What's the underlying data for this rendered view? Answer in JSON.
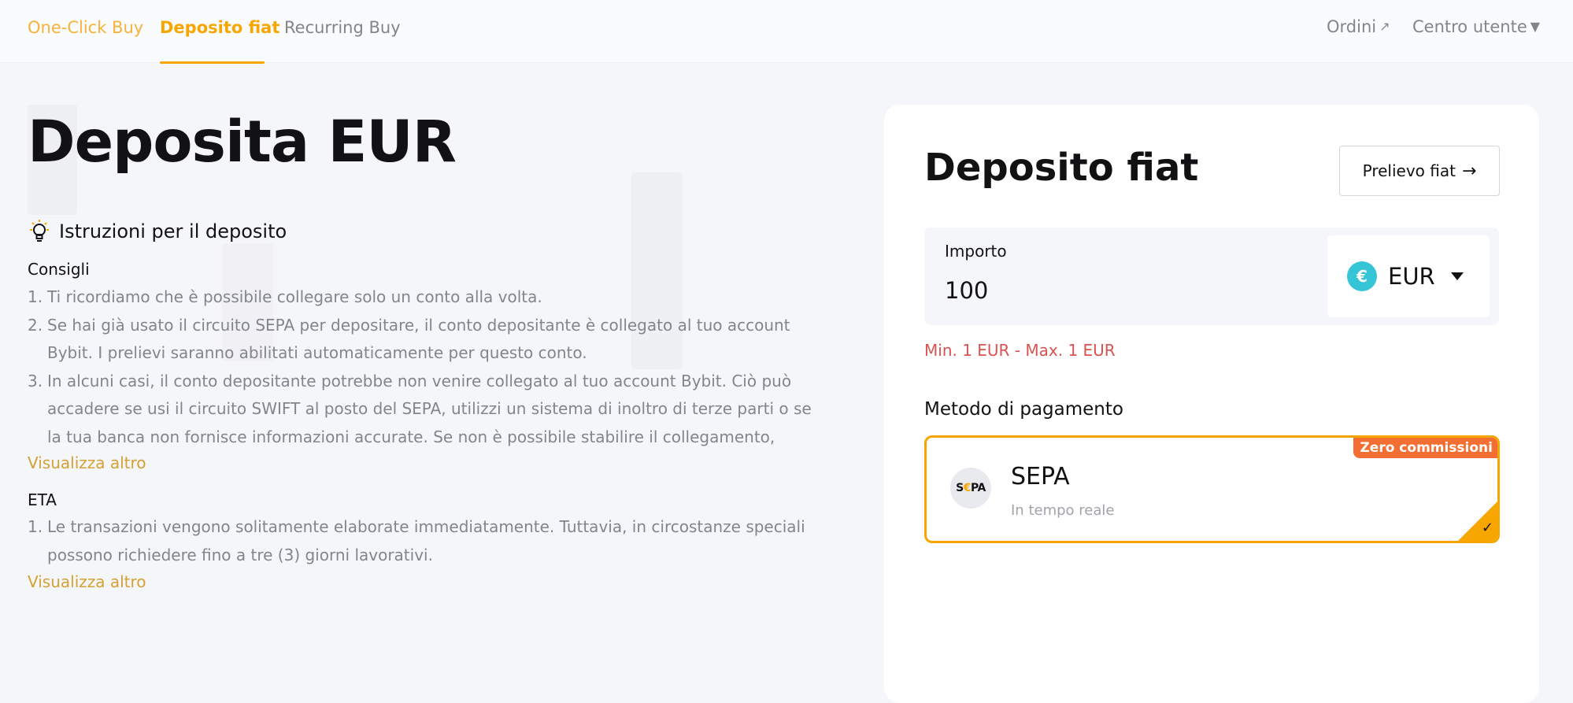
{
  "nav": {
    "tabs": [
      {
        "label": "One-Click Buy"
      },
      {
        "label": "Deposito fiat"
      },
      {
        "label": "Recurring Buy"
      }
    ],
    "orders_label": "Ordini",
    "user_center_label": "Centro utente"
  },
  "main": {
    "title": "Deposita EUR",
    "instructions_title": "Istruzioni per il deposito",
    "tips": {
      "label": "Consigli",
      "items": [
        {
          "num": "1.",
          "text": "Ti ricordiamo che è possibile collegare solo un conto alla volta."
        },
        {
          "num": "2.",
          "text": "Se hai già usato il circuito SEPA per depositare, il conto depositante è collegato al tuo account Bybit. I prelievi saranno abilitati automaticamente per questo conto."
        },
        {
          "num": "3.",
          "text": "In alcuni casi, il conto depositante potrebbe non venire collegato al tuo account Bybit. Ciò può accadere se usi il circuito SWIFT al posto del SEPA, utilizzi un sistema di inoltro di terze parti o se la tua banca non fornisce informazioni accurate. Se non è possibile stabilire il collegamento,"
        }
      ],
      "more_label": "Visualizza altro"
    },
    "eta": {
      "label": "ETA",
      "items": [
        {
          "num": "1.",
          "text": "Le transazioni vengono solitamente elaborate immediatamente. Tuttavia, in circostanze speciali possono richiedere fino a tre (3) giorni lavorativi."
        }
      ],
      "more_label": "Visualizza altro"
    }
  },
  "card": {
    "title": "Deposito fiat",
    "withdraw_label": "Prelievo fiat",
    "amount_label": "Importo",
    "amount_value": "100",
    "currency": "EUR",
    "currency_symbol": "€",
    "limits": "Min. 1 EUR - Max. 1 EUR",
    "method_label": "Metodo di pagamento",
    "method": {
      "badge": "Zero commissioni",
      "logo_text_1": "S",
      "logo_text_2": "€",
      "logo_text_3": "PA",
      "name": "SEPA",
      "subtitle": "In tempo reale",
      "selected": true
    }
  },
  "colors": {
    "accent": "#f7a600",
    "error": "#d9534f",
    "badge": "#f36e33",
    "coin": "#36c5d6"
  }
}
